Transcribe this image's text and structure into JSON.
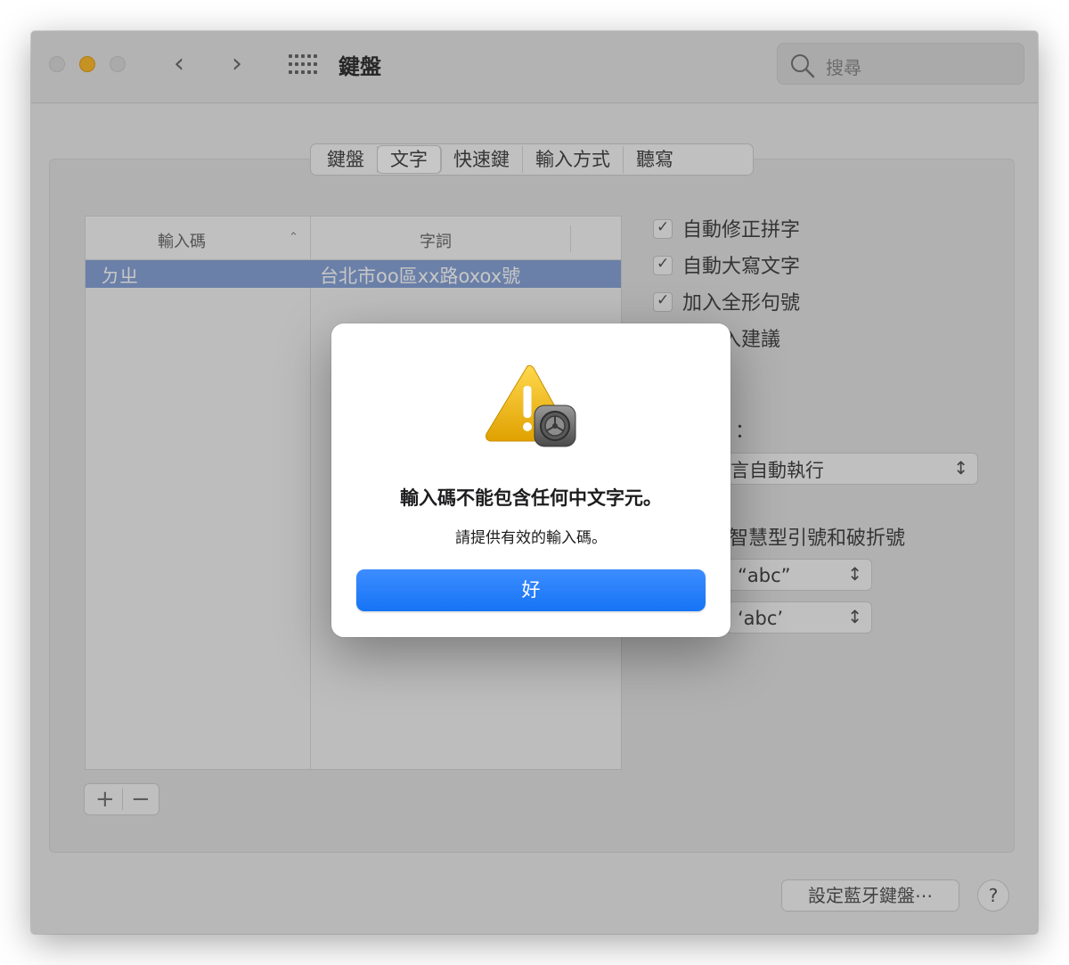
{
  "window": {
    "title": "鍵盤",
    "search_placeholder": "搜尋"
  },
  "tabs": [
    {
      "label": "鍵盤",
      "active": false
    },
    {
      "label": "文字",
      "active": true
    },
    {
      "label": "快速鍵",
      "active": false
    },
    {
      "label": "輸入方式",
      "active": false
    },
    {
      "label": "聽寫",
      "active": false
    }
  ],
  "table": {
    "headers": [
      "輸入碼",
      "字詞"
    ],
    "rows": [
      {
        "input_code": "ㄉㄓ",
        "phrase": "台北市oo區xx路oxox號",
        "selected": true
      }
    ]
  },
  "buttons": {
    "add": "+",
    "remove": "−",
    "bluetooth_keyboard": "設定藍牙鍵盤⋯",
    "help": "?"
  },
  "options": {
    "checkboxes": [
      {
        "label": "自動修正拼字",
        "checked": true
      },
      {
        "label": "自動大寫文字",
        "checked": true
      },
      {
        "label": "加入全形句號",
        "checked": true
      },
      {
        "label": "列輸入建議",
        "checked": true
      }
    ],
    "spelling_label": "：",
    "spelling_value": "言自動執行",
    "smart_quotes_label": "智慧型引號和破折號",
    "double_quotes_value": "“abc”",
    "single_quotes_value": "‘abc’"
  },
  "alert": {
    "title": "輸入碼不能包含任何中文字元。",
    "message": "請提供有效的輸入碼。",
    "ok_label": "好"
  },
  "colors": {
    "accent": "#1674f5",
    "selection": "#8aa5d8",
    "warning": "#f2b705"
  }
}
